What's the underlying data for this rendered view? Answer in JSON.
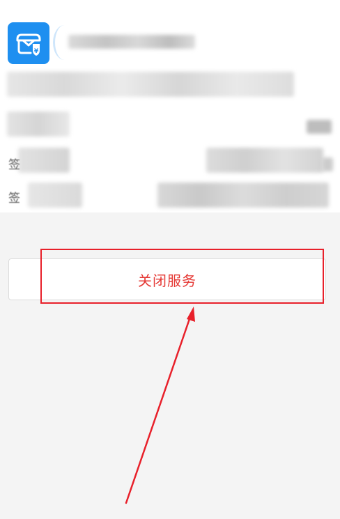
{
  "colors": {
    "app_icon_bg": "#1e8ff0",
    "close_button_text": "#e53935",
    "annotation_red": "#e8202a",
    "page_bg": "#f4f4f4"
  },
  "app_icon": {
    "name": "wallet-shield-yen-icon",
    "glyph": "¥"
  },
  "rows": {
    "row3_prefix": "签",
    "row4_prefix": "签"
  },
  "actions": {
    "close_service_label": "关闭服务"
  }
}
